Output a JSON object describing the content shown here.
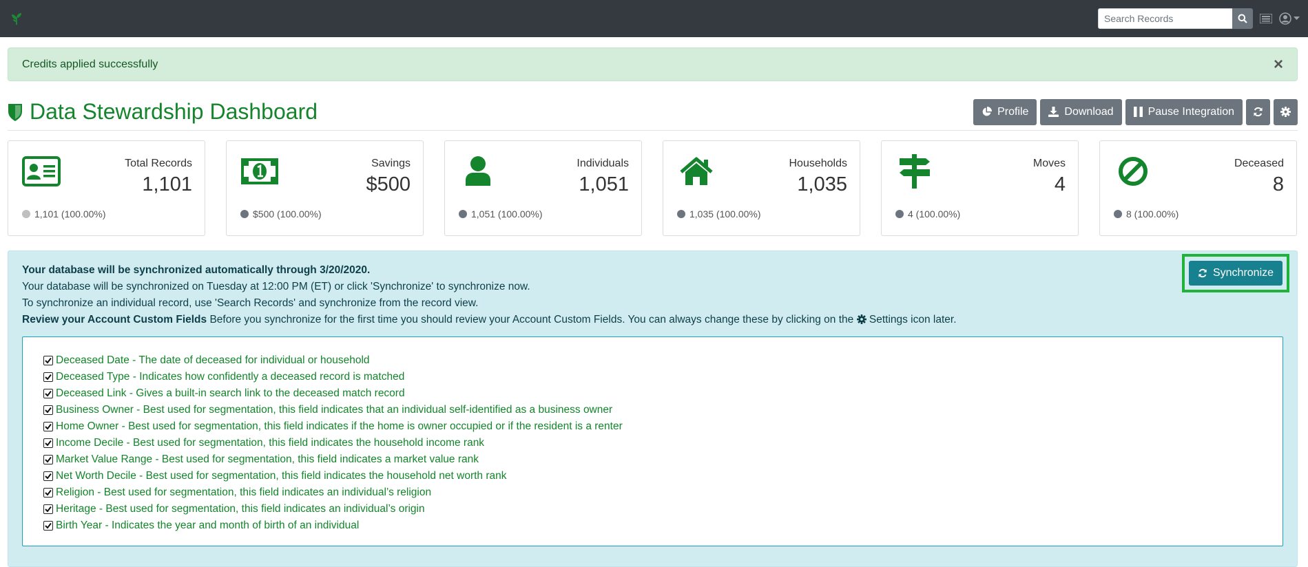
{
  "navbar": {
    "search_placeholder": "Search Records"
  },
  "alert": {
    "message": "Credits applied successfully",
    "close_glyph": "×"
  },
  "header": {
    "title": "Data Stewardship Dashboard",
    "buttons": {
      "profile": "Profile",
      "download": "Download",
      "pause": "Pause Integration"
    }
  },
  "cards": [
    {
      "label": "Total Records",
      "value": "1,101",
      "foot": "1,101 (100.00%)",
      "icon": "id-card-icon"
    },
    {
      "label": "Savings",
      "value": "$500",
      "foot": "$500 (100.00%)",
      "icon": "money-bill-icon"
    },
    {
      "label": "Individuals",
      "value": "1,051",
      "foot": "1,051 (100.00%)",
      "icon": "user-icon"
    },
    {
      "label": "Households",
      "value": "1,035",
      "foot": "1,035 (100.00%)",
      "icon": "home-icon"
    },
    {
      "label": "Moves",
      "value": "4",
      "foot": "4 (100.00%)",
      "icon": "signpost-icon"
    },
    {
      "label": "Deceased",
      "value": "8",
      "foot": "8 (100.00%)",
      "icon": "ban-icon"
    }
  ],
  "info": {
    "line1": "Your database will be synchronized automatically through 3/20/2020.",
    "line2": "Your database will be synchronized on Tuesday at 12:00 PM (ET) or click 'Synchronize' to synchronize now.",
    "line3": "To synchronize an individual record, use 'Search Records' and synchronize from the record view.",
    "review_bold": "Review your Account Custom Fields",
    "review_text": " Before you synchronize for the first time you should review your Account Custom Fields. You can always change these by clicking on the ",
    "review_tail": " Settings icon later.",
    "sync_button": "Synchronize",
    "fields": [
      "Deceased Date - The date of deceased for individual or household",
      "Deceased Type - Indicates how confidently a deceased record is matched",
      "Deceased Link - Gives a built-in search link to the deceased match record",
      "Business Owner - Best used for segmentation, this field indicates that an individual self-identified as a business owner",
      "Home Owner - Best used for segmentation, this field indicates if the home is owner occupied or if the resident is a renter",
      "Income Decile - Best used for segmentation, this field indicates the household income rank",
      "Market Value Range - Best used for segmentation, this field indicates a market value rank",
      "Net Worth Decile - Best used for segmentation, this field indicates the household net worth rank",
      "Religion - Best used for segmentation, this field indicates an individual’s religion",
      "Heritage - Best used for segmentation, this field indicates an individual’s origin",
      "Birth Year - Indicates the year and month of birth of an individual"
    ]
  },
  "colors": {
    "brand_green": "#14852c",
    "navbar": "#343a40",
    "button_gray": "#6c757d",
    "sync_teal": "#17818f",
    "highlight_green": "#1fb33b"
  }
}
